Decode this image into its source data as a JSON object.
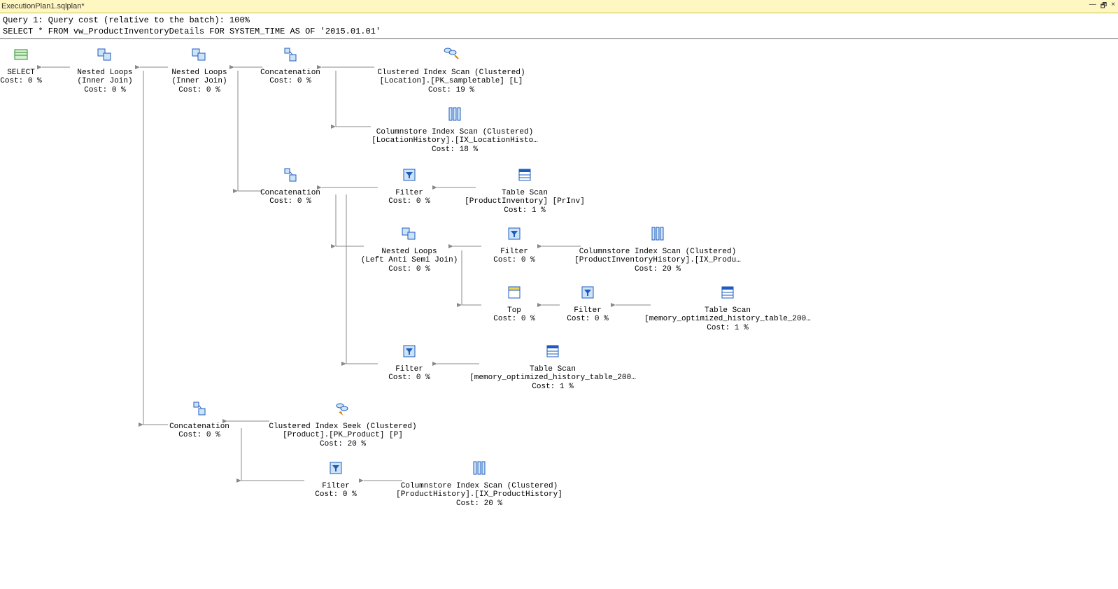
{
  "tab": {
    "title": "ExecutionPlan1.sqlplan*"
  },
  "window_controls": {
    "min": "—",
    "restore": "🗗",
    "close": "×"
  },
  "header": {
    "line1": "Query 1: Query cost (relative to the batch): 100%",
    "line2": "SELECT * FROM vw_ProductInventoryDetails FOR SYSTEM_TIME AS OF '2015.01.01'"
  },
  "nodes": {
    "select": {
      "l1": "SELECT",
      "l2": "Cost: 0 %"
    },
    "nl1": {
      "l1": "Nested Loops",
      "l2": "(Inner Join)",
      "l3": "Cost: 0 %"
    },
    "nl2": {
      "l1": "Nested Loops",
      "l2": "(Inner Join)",
      "l3": "Cost: 0 %"
    },
    "concat1": {
      "l1": "Concatenation",
      "l2": "Cost: 0 %"
    },
    "cix_loc": {
      "l1": "Clustered Index Scan (Clustered)",
      "l2": "[Location].[PK_sampletable] [L]",
      "l3": "Cost: 19 %"
    },
    "cs_loc": {
      "l1": "Columnstore Index Scan (Clustered)",
      "l2": "[LocationHistory].[IX_LocationHisto…",
      "l3": "Cost: 18 %"
    },
    "filter1": {
      "l1": "Filter",
      "l2": "Cost: 0 %"
    },
    "ts_prinv": {
      "l1": "Table Scan",
      "l2": "[ProductInventory] [PrInv]",
      "l3": "Cost: 1 %"
    },
    "concat2": {
      "l1": "Concatenation",
      "l2": "Cost: 0 %"
    },
    "nl3": {
      "l1": "Nested Loops",
      "l2": "(Left Anti Semi Join)",
      "l3": "Cost: 0 %"
    },
    "filter2": {
      "l1": "Filter",
      "l2": "Cost: 0 %"
    },
    "cs_prinv": {
      "l1": "Columnstore Index Scan (Clustered)",
      "l2": "[ProductInventoryHistory].[IX_Produ…",
      "l3": "Cost: 20 %"
    },
    "top": {
      "l1": "Top",
      "l2": "Cost: 0 %"
    },
    "filter3": {
      "l1": "Filter",
      "l2": "Cost: 0 %"
    },
    "ts_mem1": {
      "l1": "Table Scan",
      "l2": "[memory_optimized_history_table_200…",
      "l3": "Cost: 1 %"
    },
    "filter4": {
      "l1": "Filter",
      "l2": "Cost: 0 %"
    },
    "ts_mem2": {
      "l1": "Table Scan",
      "l2": "[memory_optimized_history_table_200…",
      "l3": "Cost: 1 %"
    },
    "concat3": {
      "l1": "Concatenation",
      "l2": "Cost: 0 %"
    },
    "cixseek": {
      "l1": "Clustered Index Seek (Clustered)",
      "l2": "[Product].[PK_Product] [P]",
      "l3": "Cost: 20 %"
    },
    "filter5": {
      "l1": "Filter",
      "l2": "Cost: 0 %"
    },
    "cs_prod": {
      "l1": "Columnstore Index Scan (Clustered)",
      "l2": "[ProductHistory].[IX_ProductHistory]",
      "l3": "Cost: 20 %"
    }
  }
}
